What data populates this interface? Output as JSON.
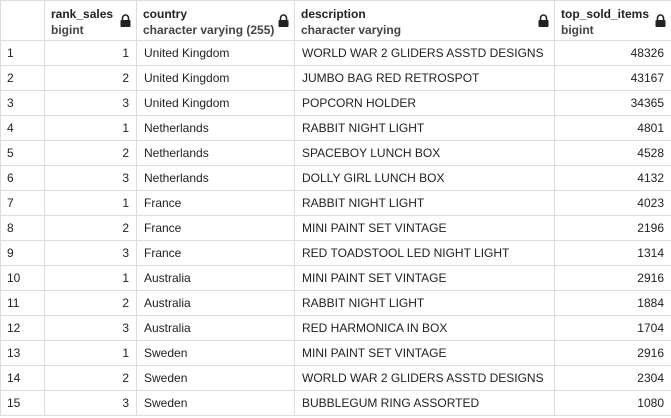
{
  "columns": [
    {
      "name": "rank_sales",
      "type": "bigint",
      "locked": true,
      "icon": "lock-icon"
    },
    {
      "name": "country",
      "type": "character varying (255)",
      "locked": true,
      "icon": "lock-icon"
    },
    {
      "name": "description",
      "type": "character varying",
      "locked": true,
      "icon": "lock-icon"
    },
    {
      "name": "top_sold_items",
      "type": "bigint",
      "locked": true,
      "icon": "lock-icon"
    }
  ],
  "rows": [
    {
      "n": "1",
      "rank_sales": "1",
      "country": "United Kingdom",
      "description": "WORLD WAR 2 GLIDERS ASSTD DESIGNS",
      "top_sold_items": "48326"
    },
    {
      "n": "2",
      "rank_sales": "2",
      "country": "United Kingdom",
      "description": "JUMBO BAG RED RETROSPOT",
      "top_sold_items": "43167"
    },
    {
      "n": "3",
      "rank_sales": "3",
      "country": "United Kingdom",
      "description": "POPCORN HOLDER",
      "top_sold_items": "34365"
    },
    {
      "n": "4",
      "rank_sales": "1",
      "country": "Netherlands",
      "description": "RABBIT NIGHT LIGHT",
      "top_sold_items": "4801"
    },
    {
      "n": "5",
      "rank_sales": "2",
      "country": "Netherlands",
      "description": "SPACEBOY LUNCH BOX",
      "top_sold_items": "4528"
    },
    {
      "n": "6",
      "rank_sales": "3",
      "country": "Netherlands",
      "description": "DOLLY GIRL LUNCH BOX",
      "top_sold_items": "4132"
    },
    {
      "n": "7",
      "rank_sales": "1",
      "country": "France",
      "description": "RABBIT NIGHT LIGHT",
      "top_sold_items": "4023"
    },
    {
      "n": "8",
      "rank_sales": "2",
      "country": "France",
      "description": "MINI PAINT SET VINTAGE",
      "top_sold_items": "2196"
    },
    {
      "n": "9",
      "rank_sales": "3",
      "country": "France",
      "description": "RED TOADSTOOL LED NIGHT LIGHT",
      "top_sold_items": "1314"
    },
    {
      "n": "10",
      "rank_sales": "1",
      "country": "Australia",
      "description": "MINI PAINT SET VINTAGE",
      "top_sold_items": "2916"
    },
    {
      "n": "11",
      "rank_sales": "2",
      "country": "Australia",
      "description": "RABBIT NIGHT LIGHT",
      "top_sold_items": "1884"
    },
    {
      "n": "12",
      "rank_sales": "3",
      "country": "Australia",
      "description": "RED  HARMONICA IN BOX",
      "top_sold_items": "1704"
    },
    {
      "n": "13",
      "rank_sales": "1",
      "country": "Sweden",
      "description": "MINI PAINT SET VINTAGE",
      "top_sold_items": "2916"
    },
    {
      "n": "14",
      "rank_sales": "2",
      "country": "Sweden",
      "description": "WORLD WAR 2 GLIDERS ASSTD DESIGNS",
      "top_sold_items": "2304"
    },
    {
      "n": "15",
      "rank_sales": "3",
      "country": "Sweden",
      "description": "BUBBLEGUM RING ASSORTED",
      "top_sold_items": "1080"
    }
  ]
}
